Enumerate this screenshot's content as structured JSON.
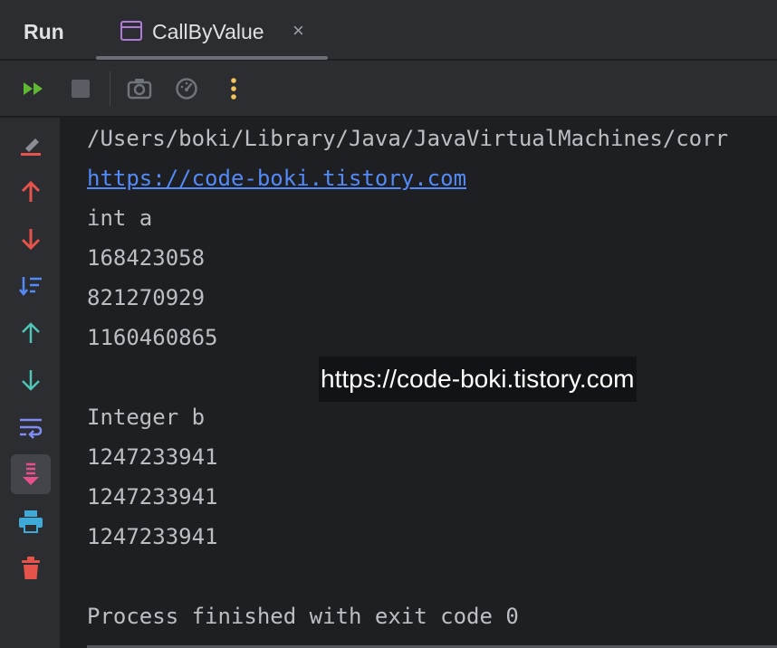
{
  "tabbar": {
    "panel_label": "Run",
    "tab": {
      "title": "CallByValue",
      "icon": "application-window-icon",
      "close_glyph": "×"
    }
  },
  "toolbar": {
    "buttons": [
      "rerun-icon",
      "stop-icon",
      "screenshot-camera-icon",
      "profiler-gauge-icon",
      "more-vertical-icon"
    ],
    "colors": {
      "rerun": "#5fb832",
      "more": "#f2c55c"
    }
  },
  "gutter": {
    "buttons": [
      "clear-all-icon",
      "previous-occurrence-icon",
      "next-occurrence-icon",
      "sort-icon",
      "up-arrow-icon",
      "down-arrow-icon",
      "soft-wrap-icon",
      "scroll-to-end-icon",
      "print-icon",
      "trash-icon"
    ]
  },
  "console": {
    "lines": [
      "/Users/boki/Library/Java/JavaVirtualMachines/corr",
      "https://code-boki.tistory.com",
      "int a",
      "168423058",
      "821270929",
      "1160460865",
      "",
      "Integer b",
      "1247233941",
      "1247233941",
      "1247233941",
      "",
      "Process finished with exit code 0"
    ],
    "watermark": "https://code-boki.tistory.com"
  }
}
